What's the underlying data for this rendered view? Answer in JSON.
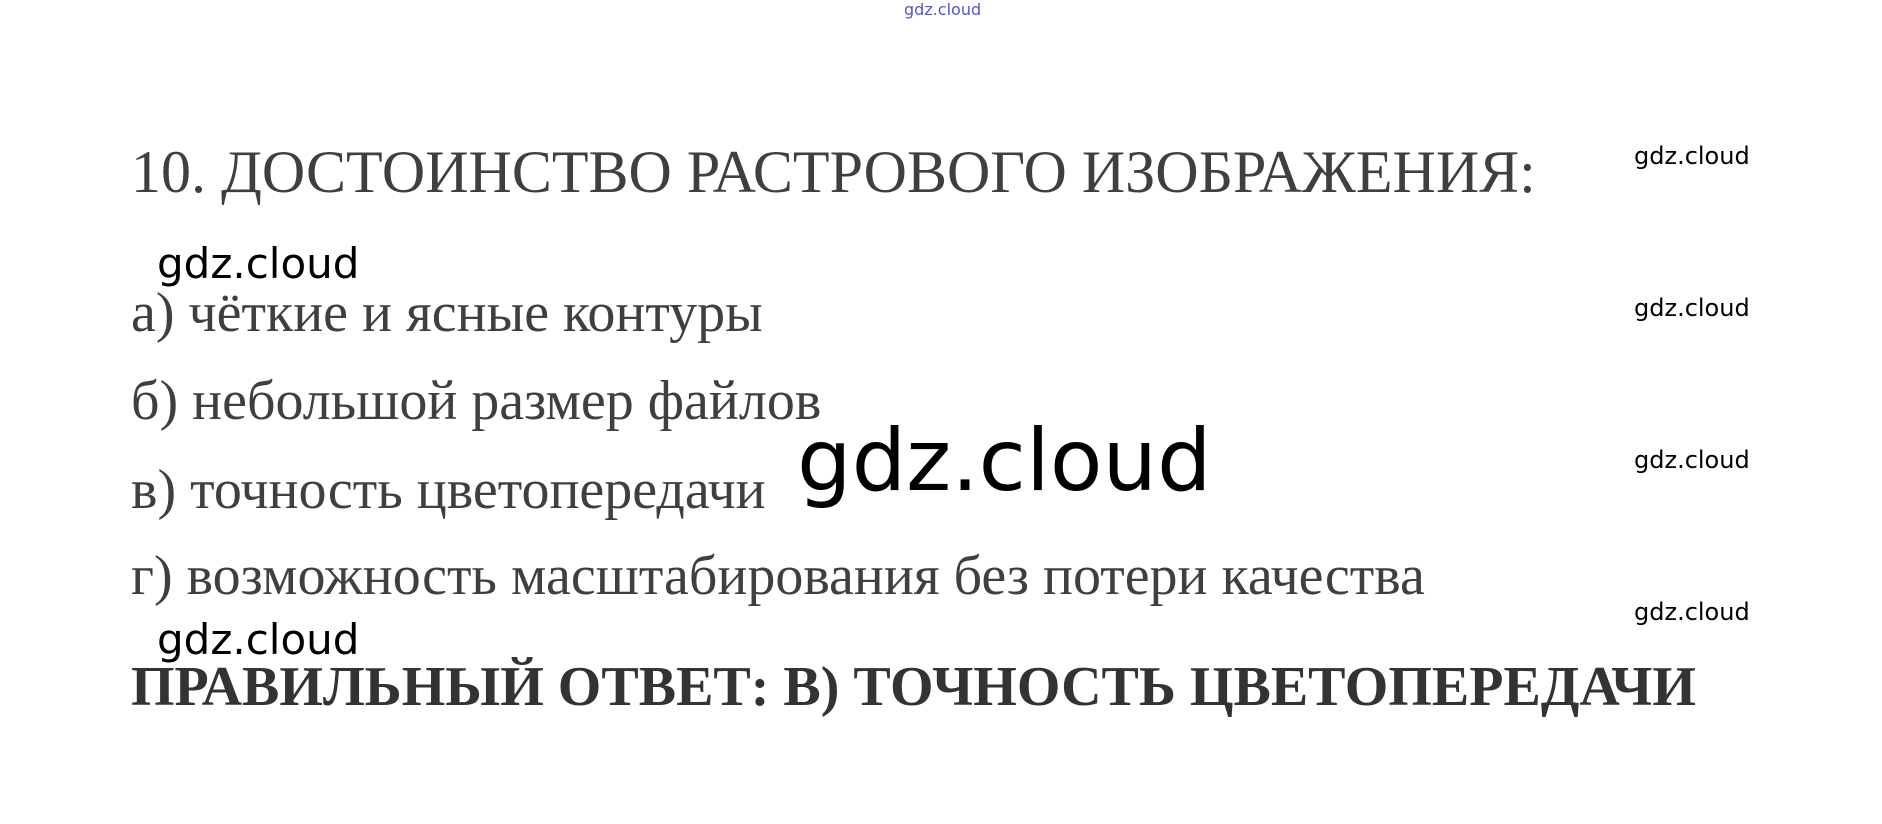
{
  "question": {
    "text": "10. ДОСТОИНСТВО РАСТРОВОГО ИЗОБРАЖЕНИЯ:"
  },
  "options": [
    "а) чёткие и ясные контуры",
    "б) небольшой размер файлов",
    "в) точность цветопередачи",
    "г) возможность масштабирования без потери качества"
  ],
  "answer": {
    "text": "ПРАВИЛЬНЫЙ ОТВЕТ: В) ТОЧНОСТЬ ЦВЕТОПЕРЕДАЧИ"
  },
  "watermark": {
    "text": "gdz.cloud"
  },
  "colors": {
    "text": "#3f3f3f",
    "answer": "#333333",
    "watermark": "#000000",
    "watermark_top": "#5555cc",
    "background": "#ffffff"
  }
}
